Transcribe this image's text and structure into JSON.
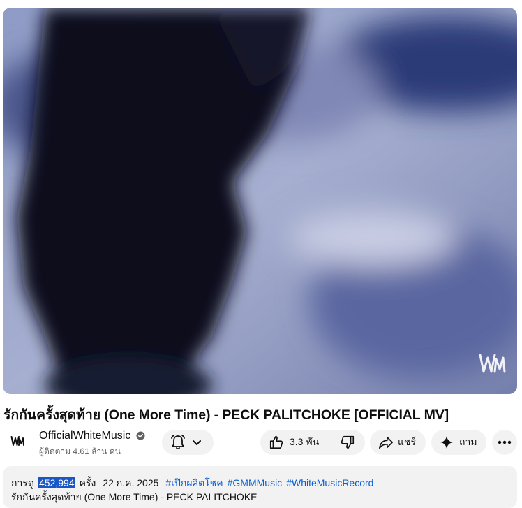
{
  "video": {
    "title": "รักกันครั้งสุดท้าย (One More Time) - PECK PALITCHOKE [OFFICIAL MV]",
    "watermark": "WM"
  },
  "channel": {
    "name": "OfficialWhiteMusic",
    "subscribers": "ผู้ติดตาม 4.61 ล้าน คน",
    "avatar_text": "WM",
    "verified_icon": "check-circle-icon"
  },
  "actions": {
    "subscribe_icon": "bell-icon",
    "likes": "3.3 พัน",
    "share_label": "แชร์",
    "ask_label": "ถาม"
  },
  "description": {
    "views_prefix": "การดู",
    "views_count": "452,994",
    "views_suffix": "ครั้ง",
    "date": "22 ก.ค. 2025",
    "hashtags": [
      "#เป๊กผลิตโชค",
      "#GMMMusic",
      "#WhiteMusicRecord"
    ],
    "text": "รักกันครั้งสุดท้าย (One More Time) - PECK PALITCHOKE"
  },
  "colors": {
    "pill_bg": "#f2f2f2",
    "link": "#065fd4",
    "selection": "#1a56c6"
  }
}
